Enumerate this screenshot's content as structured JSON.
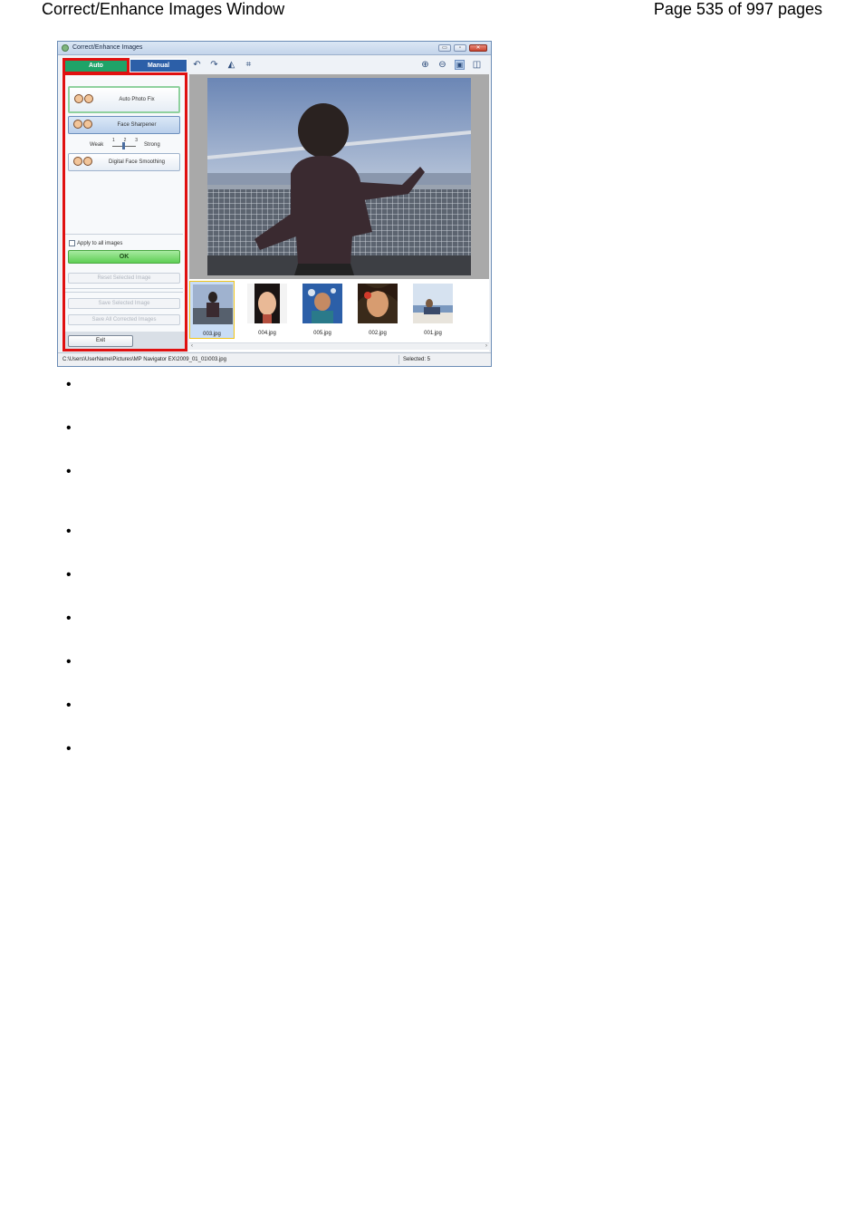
{
  "page_header": {
    "title": "Correct/Enhance Images Window",
    "page_info": "Page 535 of 997 pages"
  },
  "window": {
    "title": "Correct/Enhance Images",
    "controls": {
      "minimize": "▭",
      "maximize": "▫",
      "close": "✕"
    },
    "tabs": [
      {
        "label": "Auto",
        "active": true
      },
      {
        "label": "Manual",
        "active": false
      }
    ],
    "functions": {
      "auto_photo_fix": "Auto Photo Fix",
      "face_sharpener": "Face Sharpener",
      "digital_face_smoothing": "Digital Face Smoothing"
    },
    "slider": {
      "weak": "Weak",
      "strong": "Strong",
      "ticks": [
        "1",
        "2",
        "3"
      ],
      "value": 2
    },
    "apply_all": "Apply to all images",
    "ok": "OK",
    "reset_selected": "Reset Selected Image",
    "save_selected": "Save Selected Image",
    "save_all": "Save All Corrected Images",
    "exit": "Exit",
    "toolbar_icons": [
      "rotate-left-icon",
      "rotate-right-icon",
      "mirror-icon",
      "crop-icon",
      "zoom-in-icon",
      "zoom-out-icon",
      "whole-image-view-icon",
      "compare-view-icon"
    ],
    "thumbnails": [
      {
        "name": "003.jpg",
        "selected": true
      },
      {
        "name": "004.jpg",
        "selected": false
      },
      {
        "name": "005.jpg",
        "selected": false
      },
      {
        "name": "002.jpg",
        "selected": false
      },
      {
        "name": "001.jpg",
        "selected": false
      }
    ],
    "status_path": "C:\\Users\\UserName\\Pictures\\MP Navigator EX\\2009_01_01\\003.jpg",
    "status_selected": "Selected: 5",
    "colors": {
      "highlight_box": "#e01010",
      "auto_tab": "#1fa368",
      "manual_tab": "#2c5fa8"
    }
  },
  "bullet_count": 9
}
